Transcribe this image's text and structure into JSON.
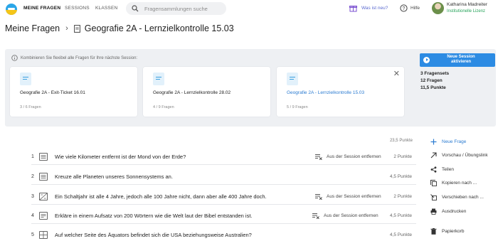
{
  "nav": {
    "items": [
      {
        "label": "MEINE FRAGEN",
        "active": true
      },
      {
        "label": "SESSIONS",
        "active": false
      },
      {
        "label": "KLASSEN",
        "active": false
      }
    ],
    "search_placeholder": "Fragensammlungen suche",
    "whats_new": "Was ist neu?",
    "help": "Hilfe",
    "user_name": "Katharina Madreiter",
    "license": "Institutionelle Lizenz"
  },
  "breadcrumb": {
    "root": "Meine Fragen",
    "current": "Geografie 2A - Lernzielkontrolle 15.03"
  },
  "session": {
    "hint": "Kombinieren Sie flexibel alle Fragen für Ihre nächste Session:",
    "cards": [
      {
        "title": "Geografie 2A - Exit-Ticket 16.01",
        "count": "3 / 6 Fragen"
      },
      {
        "title": "Geografie 2A - Lernzielkontrolle 28.02",
        "count": "4 / 9 Fragen"
      },
      {
        "title": "Geografie 2A - Lernzielkontrolle 15.03",
        "count": "5 / 9 Fragen"
      }
    ],
    "activate_line1": "Neue Session",
    "activate_line2": "aktivieren",
    "stats": [
      "3 Fragensets",
      "12 Fragen",
      "11,5 Punkte"
    ]
  },
  "questions": {
    "total": "23,5 Punkte",
    "remove_label": "Aus der Session entfernen",
    "rows": [
      {
        "num": "1",
        "text": "Wie viele Kilometer entfernt ist der Mond von der Erde?",
        "points": "2 Punkte",
        "in_session": true,
        "icon": "list-icon"
      },
      {
        "num": "2",
        "text": "Kreuze alle Planeten unseres Sonnensystems an.",
        "points": "4,5 Punkte",
        "in_session": false,
        "icon": "list-icon"
      },
      {
        "num": "3",
        "text": "Ein Schaltjahr ist alle 4 Jahre, jedoch alle 100 Jahre nicht, dann aber alle 400 Jahre doch.",
        "points": "2 Punkte",
        "in_session": true,
        "icon": "true-false-icon"
      },
      {
        "num": "4",
        "text": "Erkläre in einem Aufsatz von 200 Wörtern wie die Welt laut der Bibel entstanden ist.",
        "points": "4,5 Punkte",
        "in_session": true,
        "icon": "text-answer-icon"
      },
      {
        "num": "5",
        "text": "Auf welcher Seite des Äquators befindet sich die USA beziehungsweise Australien?",
        "points": "4,5 Punkte",
        "in_session": false,
        "icon": "sort-icon"
      }
    ]
  },
  "actions": {
    "new_question": "Neue Frage",
    "preview": "Vorschau / Übungslink",
    "share": "Teilen",
    "copy": "Kopieren nach ...",
    "move": "Verschieben nach ...",
    "print": "Ausdrucken",
    "trash": "Papierkorb"
  },
  "colors": {
    "accent": "#2c8be3",
    "license": "#27a35a",
    "panel": "#eef0f3"
  }
}
